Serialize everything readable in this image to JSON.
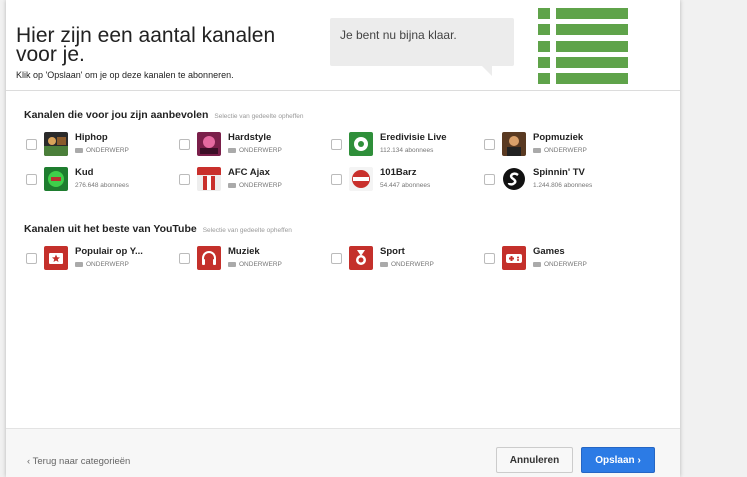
{
  "header": {
    "title": "Hier zijn een aantal kanalen voor je.",
    "subtitle": "Klik op 'Opslaan' om je op deze kanalen te abonneren.",
    "bubble_text": "Je bent nu bijna klaar."
  },
  "sections": [
    {
      "title": "Kanalen die voor jou zijn aanbevolen",
      "deselect": "Selectie van gedeelte opheffen",
      "items": [
        {
          "name": "Hiphop",
          "meta": "ONDERWERP",
          "tag": true,
          "icon": "hiphop-thumb"
        },
        {
          "name": "Hardstyle",
          "meta": "ONDERWERP",
          "tag": true,
          "icon": "hardstyle-thumb"
        },
        {
          "name": "Eredivisie Live",
          "meta": "112.134 abonnees",
          "tag": false,
          "icon": "eredivisie-thumb"
        },
        {
          "name": "Popmuziek",
          "meta": "ONDERWERP",
          "tag": true,
          "icon": "popmuziek-thumb"
        },
        {
          "name": "Kud",
          "meta": "276.648 abonnees",
          "tag": false,
          "icon": "kud-thumb"
        },
        {
          "name": "AFC Ajax",
          "meta": "ONDERWERP",
          "tag": true,
          "icon": "ajax-thumb"
        },
        {
          "name": "101Barz",
          "meta": "54.447 abonnees",
          "tag": false,
          "icon": "101barz-thumb"
        },
        {
          "name": "Spinnin' TV",
          "meta": "1.244.806 abonnees",
          "tag": false,
          "icon": "spinnin-thumb"
        }
      ]
    },
    {
      "title": "Kanalen uit het beste van YouTube",
      "deselect": "Selectie van gedeelte opheffen",
      "items": [
        {
          "name": "Populair op Y...",
          "meta": "ONDERWERP",
          "tag": true,
          "icon": "star-icon"
        },
        {
          "name": "Muziek",
          "meta": "ONDERWERP",
          "tag": true,
          "icon": "headphones-icon"
        },
        {
          "name": "Sport",
          "meta": "ONDERWERP",
          "tag": true,
          "icon": "medal-icon"
        },
        {
          "name": "Games",
          "meta": "ONDERWERP",
          "tag": true,
          "icon": "gamepad-icon"
        }
      ]
    }
  ],
  "footer": {
    "back_label": "‹ Terug naar categorieën",
    "cancel_label": "Annuleren",
    "save_label": "Opslaan ›"
  },
  "colors": {
    "accent": "#2c7be5",
    "preview_green": "#5fa34a",
    "youtube_red": "#c4302b"
  }
}
